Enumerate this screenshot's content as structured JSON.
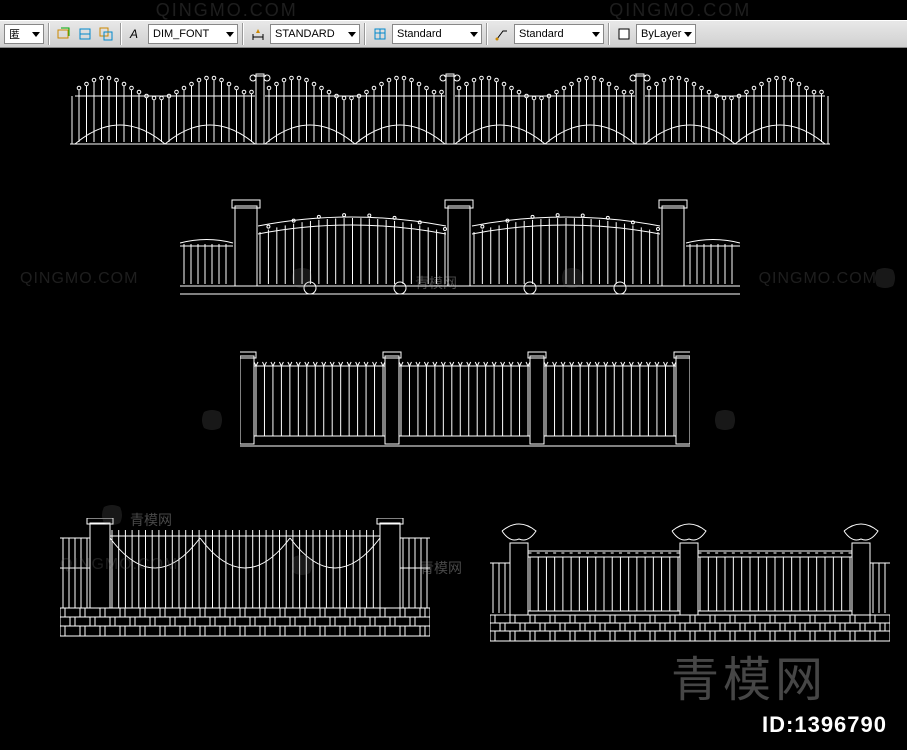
{
  "top_watermarks": [
    "QINGMO.COM",
    "QINGMO.COM"
  ],
  "toolbar": {
    "layer_dropdown": "匿",
    "dim_style": "DIM_FONT",
    "text_style": "STANDARD",
    "table_style1": "Standard",
    "table_style2": "Standard",
    "color": "ByLayer"
  },
  "watermarks": {
    "qingmo1": "QINGMO.COM",
    "qingmo2": "QINGMO.COM",
    "qingmo3": "QINGMO.COM",
    "cn_small1": "青模网",
    "cn_small2": "青模网",
    "cn_small3": "青模网",
    "big": "青模网"
  },
  "id_label": "ID:1396790"
}
